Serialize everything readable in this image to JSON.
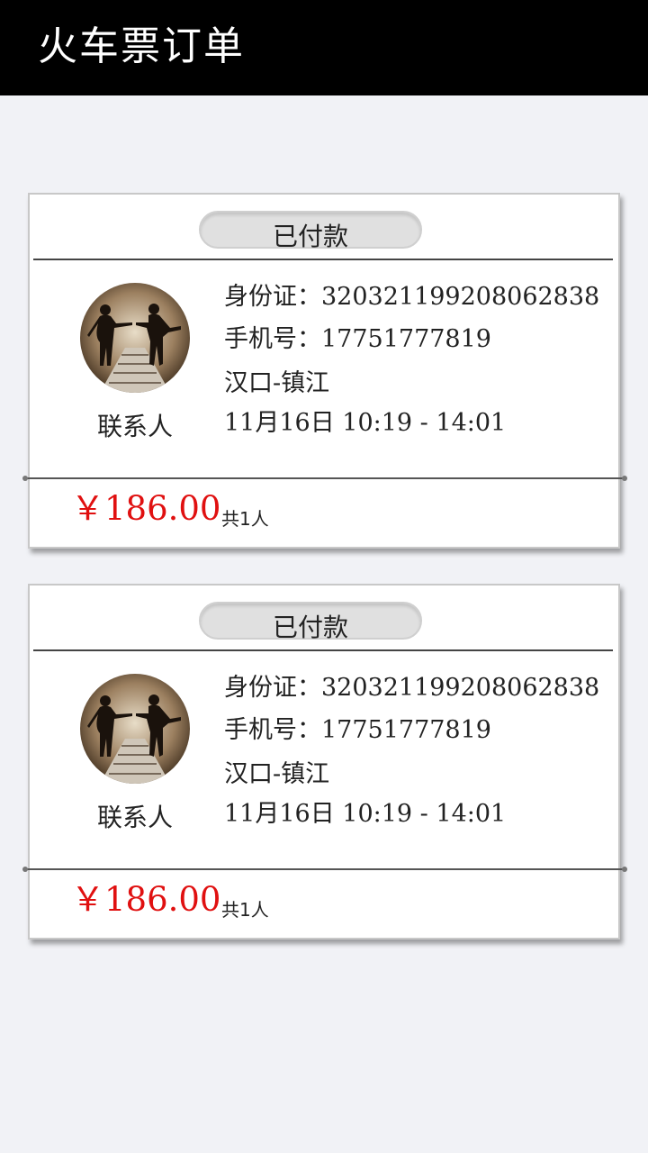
{
  "header": {
    "title": "火车票订单"
  },
  "orders": [
    {
      "status": "已付款",
      "contact_label": "联系人",
      "id_label": "身份证：",
      "id_value": "320321199208062838",
      "phone_label": "手机号：",
      "phone_value": "17751777819",
      "route": "汉口-镇江",
      "datetime": "11月16日  10:19 - 14:01",
      "price": "￥186.00",
      "count": "共1人"
    },
    {
      "status": "已付款",
      "contact_label": "联系人",
      "id_label": "身份证：",
      "id_value": "320321199208062838",
      "phone_label": "手机号：",
      "phone_value": "17751777819",
      "route": "汉口-镇江",
      "datetime": "11月16日  10:19 - 14:01",
      "price": "￥186.00",
      "count": "共1人"
    }
  ],
  "colors": {
    "price": "#e01010",
    "header_bg": "#000000",
    "page_bg": "#f1f2f6"
  }
}
